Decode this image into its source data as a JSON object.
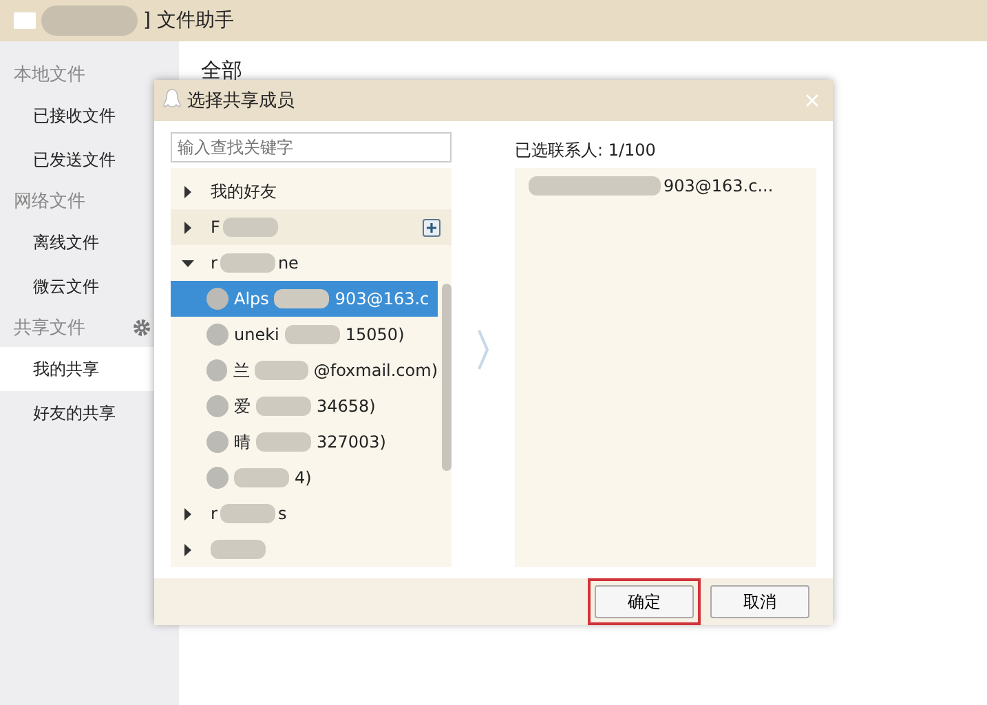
{
  "window": {
    "title": "] 文件助手"
  },
  "sidebar": {
    "sections": [
      {
        "title": "本地文件",
        "items": [
          {
            "label": "已接收文件",
            "selected": false
          },
          {
            "label": "已发送文件",
            "selected": false
          }
        ]
      },
      {
        "title": "网络文件",
        "items": [
          {
            "label": "离线文件",
            "selected": false
          },
          {
            "label": "微云文件",
            "selected": false
          }
        ]
      },
      {
        "title": "共享文件",
        "gear": true,
        "items": [
          {
            "label": "我的共享",
            "selected": true
          },
          {
            "label": "好友的共享",
            "selected": false
          }
        ]
      }
    ]
  },
  "main": {
    "heading": "全部"
  },
  "dialog": {
    "title": "选择共享成员",
    "search": {
      "placeholder": "输入查找关键字"
    },
    "groups": [
      {
        "before": "我的好友",
        "redacted": false,
        "expanded": false,
        "hover": false,
        "add_button": false
      },
      {
        "before": "F",
        "redacted": true,
        "expanded": false,
        "hover": true,
        "add_button": true
      },
      {
        "before": "r",
        "redacted": true,
        "after": "ne",
        "expanded": true,
        "hover": false,
        "add_button": false,
        "children": [
          {
            "before": "Alps",
            "after": "903@163.c",
            "selected": true
          },
          {
            "before": "uneki",
            "after": "15050)",
            "selected": false
          },
          {
            "before": "兰",
            "after": "@foxmail.com)",
            "selected": false
          },
          {
            "before": "爱",
            "after": "34658)",
            "selected": false
          },
          {
            "before": "晴",
            "after": "327003)",
            "selected": false
          },
          {
            "after": "4)",
            "selected": false
          }
        ]
      },
      {
        "before": "r",
        "redacted": true,
        "after": "s",
        "expanded": false,
        "hover": false,
        "add_button": false
      },
      {
        "redacted": true,
        "expanded": false,
        "hover": false,
        "add_button": false
      }
    ],
    "selected_label": "已选联系人: 1/100",
    "selected_items": [
      {
        "after": "903@163.c..."
      }
    ],
    "buttons": [
      {
        "label": "确定",
        "highlighted": true
      },
      {
        "label": "取消"
      }
    ]
  }
}
